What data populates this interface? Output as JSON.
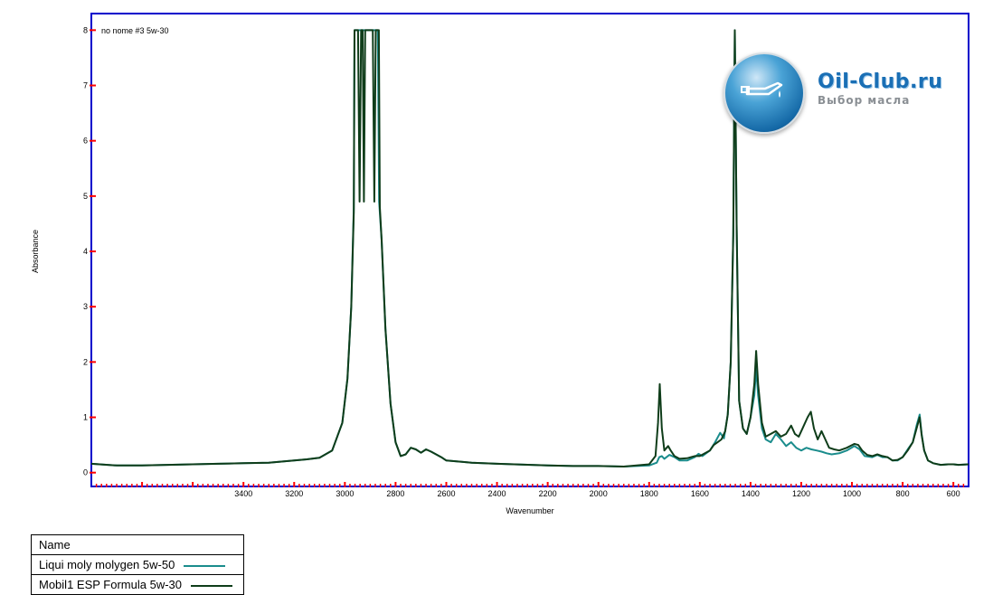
{
  "chart_data": {
    "type": "line",
    "title": "no nome #3 5w-30",
    "xlabel": "Wavenumber",
    "ylabel": "Absorbance",
    "xlim": [
      4000,
      540
    ],
    "ylim": [
      -0.25,
      8.3
    ],
    "x_reversed": true,
    "x_ticks": [
      3400,
      3200,
      3000,
      2800,
      2600,
      2400,
      2200,
      2000,
      1800,
      1600,
      1400,
      1200,
      1000,
      800,
      600
    ],
    "y_ticks": [
      0,
      1,
      2,
      3,
      4,
      5,
      6,
      7,
      8
    ],
    "series": [
      {
        "name": "Liqui moly molygen 5w-50",
        "color": "#1a8c8c",
        "points": [
          [
            4000,
            0.16
          ],
          [
            3900,
            0.13
          ],
          [
            3800,
            0.13
          ],
          [
            3700,
            0.14
          ],
          [
            3600,
            0.15
          ],
          [
            3500,
            0.16
          ],
          [
            3400,
            0.17
          ],
          [
            3300,
            0.18
          ],
          [
            3200,
            0.22
          ],
          [
            3150,
            0.24
          ],
          [
            3100,
            0.27
          ],
          [
            3050,
            0.4
          ],
          [
            3010,
            0.9
          ],
          [
            2990,
            1.7
          ],
          [
            2975,
            3.0
          ],
          [
            2965,
            4.8
          ],
          [
            2962,
            8.0
          ],
          [
            2950,
            8.0
          ],
          [
            2940,
            8.0
          ],
          [
            2930,
            8.0
          ],
          [
            2920,
            8.0
          ],
          [
            2910,
            8.0
          ],
          [
            2900,
            8.0
          ],
          [
            2890,
            8.0
          ],
          [
            2880,
            8.0
          ],
          [
            2870,
            8.0
          ],
          [
            2865,
            4.9
          ],
          [
            2855,
            4.2
          ],
          [
            2840,
            2.6
          ],
          [
            2820,
            1.25
          ],
          [
            2800,
            0.55
          ],
          [
            2780,
            0.3
          ],
          [
            2760,
            0.33
          ],
          [
            2740,
            0.45
          ],
          [
            2720,
            0.42
          ],
          [
            2700,
            0.36
          ],
          [
            2680,
            0.42
          ],
          [
            2660,
            0.38
          ],
          [
            2620,
            0.28
          ],
          [
            2600,
            0.22
          ],
          [
            2500,
            0.18
          ],
          [
            2400,
            0.16
          ],
          [
            2200,
            0.13
          ],
          [
            2100,
            0.12
          ],
          [
            2000,
            0.12
          ],
          [
            1900,
            0.11
          ],
          [
            1800,
            0.13
          ],
          [
            1770,
            0.18
          ],
          [
            1760,
            0.28
          ],
          [
            1750,
            0.3
          ],
          [
            1740,
            0.25
          ],
          [
            1720,
            0.32
          ],
          [
            1700,
            0.28
          ],
          [
            1680,
            0.22
          ],
          [
            1650,
            0.22
          ],
          [
            1620,
            0.28
          ],
          [
            1605,
            0.34
          ],
          [
            1590,
            0.3
          ],
          [
            1560,
            0.4
          ],
          [
            1540,
            0.55
          ],
          [
            1520,
            0.72
          ],
          [
            1505,
            0.62
          ],
          [
            1490,
            1.05
          ],
          [
            1478,
            2.0
          ],
          [
            1468,
            4.3
          ],
          [
            1462,
            8.0
          ],
          [
            1455,
            4.5
          ],
          [
            1445,
            1.3
          ],
          [
            1430,
            0.8
          ],
          [
            1415,
            0.7
          ],
          [
            1400,
            1.0
          ],
          [
            1385,
            1.4
          ],
          [
            1378,
            1.9
          ],
          [
            1370,
            1.4
          ],
          [
            1355,
            0.8
          ],
          [
            1340,
            0.6
          ],
          [
            1320,
            0.55
          ],
          [
            1300,
            0.7
          ],
          [
            1280,
            0.6
          ],
          [
            1260,
            0.48
          ],
          [
            1240,
            0.55
          ],
          [
            1220,
            0.45
          ],
          [
            1200,
            0.4
          ],
          [
            1180,
            0.45
          ],
          [
            1160,
            0.42
          ],
          [
            1140,
            0.4
          ],
          [
            1120,
            0.38
          ],
          [
            1100,
            0.35
          ],
          [
            1080,
            0.33
          ],
          [
            1050,
            0.35
          ],
          [
            1020,
            0.4
          ],
          [
            990,
            0.48
          ],
          [
            970,
            0.42
          ],
          [
            950,
            0.3
          ],
          [
            920,
            0.28
          ],
          [
            900,
            0.32
          ],
          [
            880,
            0.28
          ],
          [
            860,
            0.28
          ],
          [
            840,
            0.22
          ],
          [
            820,
            0.22
          ],
          [
            800,
            0.28
          ],
          [
            780,
            0.42
          ],
          [
            760,
            0.55
          ],
          [
            745,
            0.85
          ],
          [
            733,
            1.05
          ],
          [
            725,
            0.7
          ],
          [
            715,
            0.4
          ],
          [
            700,
            0.22
          ],
          [
            680,
            0.17
          ],
          [
            650,
            0.14
          ],
          [
            620,
            0.15
          ],
          [
            600,
            0.15
          ],
          [
            580,
            0.14
          ],
          [
            540,
            0.15
          ]
        ]
      },
      {
        "name": "Mobil1 ESP Formula 5w-30",
        "color": "#0f3d1a",
        "points": [
          [
            4000,
            0.16
          ],
          [
            3900,
            0.13
          ],
          [
            3800,
            0.13
          ],
          [
            3700,
            0.14
          ],
          [
            3600,
            0.15
          ],
          [
            3500,
            0.16
          ],
          [
            3400,
            0.17
          ],
          [
            3300,
            0.18
          ],
          [
            3200,
            0.22
          ],
          [
            3150,
            0.24
          ],
          [
            3100,
            0.27
          ],
          [
            3050,
            0.4
          ],
          [
            3010,
            0.9
          ],
          [
            2990,
            1.7
          ],
          [
            2975,
            3.0
          ],
          [
            2965,
            4.7
          ],
          [
            2962,
            8.0
          ],
          [
            2955,
            8.0
          ],
          [
            2948,
            8.0
          ],
          [
            2942,
            4.9
          ],
          [
            2936,
            8.0
          ],
          [
            2930,
            8.0
          ],
          [
            2925,
            4.9
          ],
          [
            2920,
            8.0
          ],
          [
            2900,
            8.0
          ],
          [
            2890,
            8.0
          ],
          [
            2884,
            4.9
          ],
          [
            2878,
            8.0
          ],
          [
            2872,
            8.0
          ],
          [
            2866,
            8.0
          ],
          [
            2862,
            4.8
          ],
          [
            2855,
            4.2
          ],
          [
            2840,
            2.6
          ],
          [
            2820,
            1.25
          ],
          [
            2800,
            0.55
          ],
          [
            2780,
            0.3
          ],
          [
            2760,
            0.33
          ],
          [
            2740,
            0.45
          ],
          [
            2720,
            0.42
          ],
          [
            2700,
            0.36
          ],
          [
            2680,
            0.42
          ],
          [
            2660,
            0.38
          ],
          [
            2620,
            0.28
          ],
          [
            2600,
            0.22
          ],
          [
            2500,
            0.18
          ],
          [
            2400,
            0.16
          ],
          [
            2200,
            0.13
          ],
          [
            2100,
            0.12
          ],
          [
            2000,
            0.12
          ],
          [
            1900,
            0.11
          ],
          [
            1800,
            0.15
          ],
          [
            1775,
            0.3
          ],
          [
            1765,
            0.9
          ],
          [
            1758,
            1.6
          ],
          [
            1750,
            0.8
          ],
          [
            1740,
            0.4
          ],
          [
            1725,
            0.48
          ],
          [
            1715,
            0.4
          ],
          [
            1700,
            0.3
          ],
          [
            1680,
            0.25
          ],
          [
            1650,
            0.26
          ],
          [
            1620,
            0.3
          ],
          [
            1600,
            0.3
          ],
          [
            1560,
            0.4
          ],
          [
            1545,
            0.5
          ],
          [
            1530,
            0.55
          ],
          [
            1515,
            0.6
          ],
          [
            1500,
            0.75
          ],
          [
            1490,
            1.05
          ],
          [
            1478,
            2.0
          ],
          [
            1468,
            4.3
          ],
          [
            1462,
            8.0
          ],
          [
            1455,
            4.5
          ],
          [
            1445,
            1.3
          ],
          [
            1430,
            0.8
          ],
          [
            1415,
            0.7
          ],
          [
            1400,
            1.0
          ],
          [
            1385,
            1.6
          ],
          [
            1378,
            2.2
          ],
          [
            1370,
            1.6
          ],
          [
            1355,
            0.9
          ],
          [
            1340,
            0.65
          ],
          [
            1320,
            0.7
          ],
          [
            1300,
            0.75
          ],
          [
            1280,
            0.65
          ],
          [
            1260,
            0.7
          ],
          [
            1240,
            0.85
          ],
          [
            1225,
            0.7
          ],
          [
            1210,
            0.65
          ],
          [
            1195,
            0.8
          ],
          [
            1175,
            1.0
          ],
          [
            1162,
            1.1
          ],
          [
            1150,
            0.8
          ],
          [
            1135,
            0.6
          ],
          [
            1120,
            0.75
          ],
          [
            1105,
            0.6
          ],
          [
            1090,
            0.45
          ],
          [
            1070,
            0.42
          ],
          [
            1050,
            0.4
          ],
          [
            1020,
            0.45
          ],
          [
            990,
            0.52
          ],
          [
            975,
            0.5
          ],
          [
            960,
            0.4
          ],
          [
            940,
            0.32
          ],
          [
            920,
            0.3
          ],
          [
            900,
            0.33
          ],
          [
            880,
            0.3
          ],
          [
            860,
            0.28
          ],
          [
            840,
            0.22
          ],
          [
            820,
            0.23
          ],
          [
            800,
            0.28
          ],
          [
            780,
            0.4
          ],
          [
            760,
            0.55
          ],
          [
            745,
            0.8
          ],
          [
            733,
            1.0
          ],
          [
            725,
            0.68
          ],
          [
            715,
            0.4
          ],
          [
            700,
            0.22
          ],
          [
            680,
            0.17
          ],
          [
            650,
            0.14
          ],
          [
            620,
            0.15
          ],
          [
            600,
            0.15
          ],
          [
            580,
            0.14
          ],
          [
            540,
            0.15
          ]
        ]
      }
    ],
    "legend": {
      "header": "Name",
      "entries": [
        "Liqui moly molygen 5w-50",
        "Mobil1 ESP Formula 5w-30"
      ],
      "placement": "bottom-left"
    },
    "grid": false,
    "frame_color": "#0000cc",
    "tick_color": "#ff0000"
  },
  "logo": {
    "brand": "Oil-Club.ru",
    "slogan": "Выбор масла"
  }
}
